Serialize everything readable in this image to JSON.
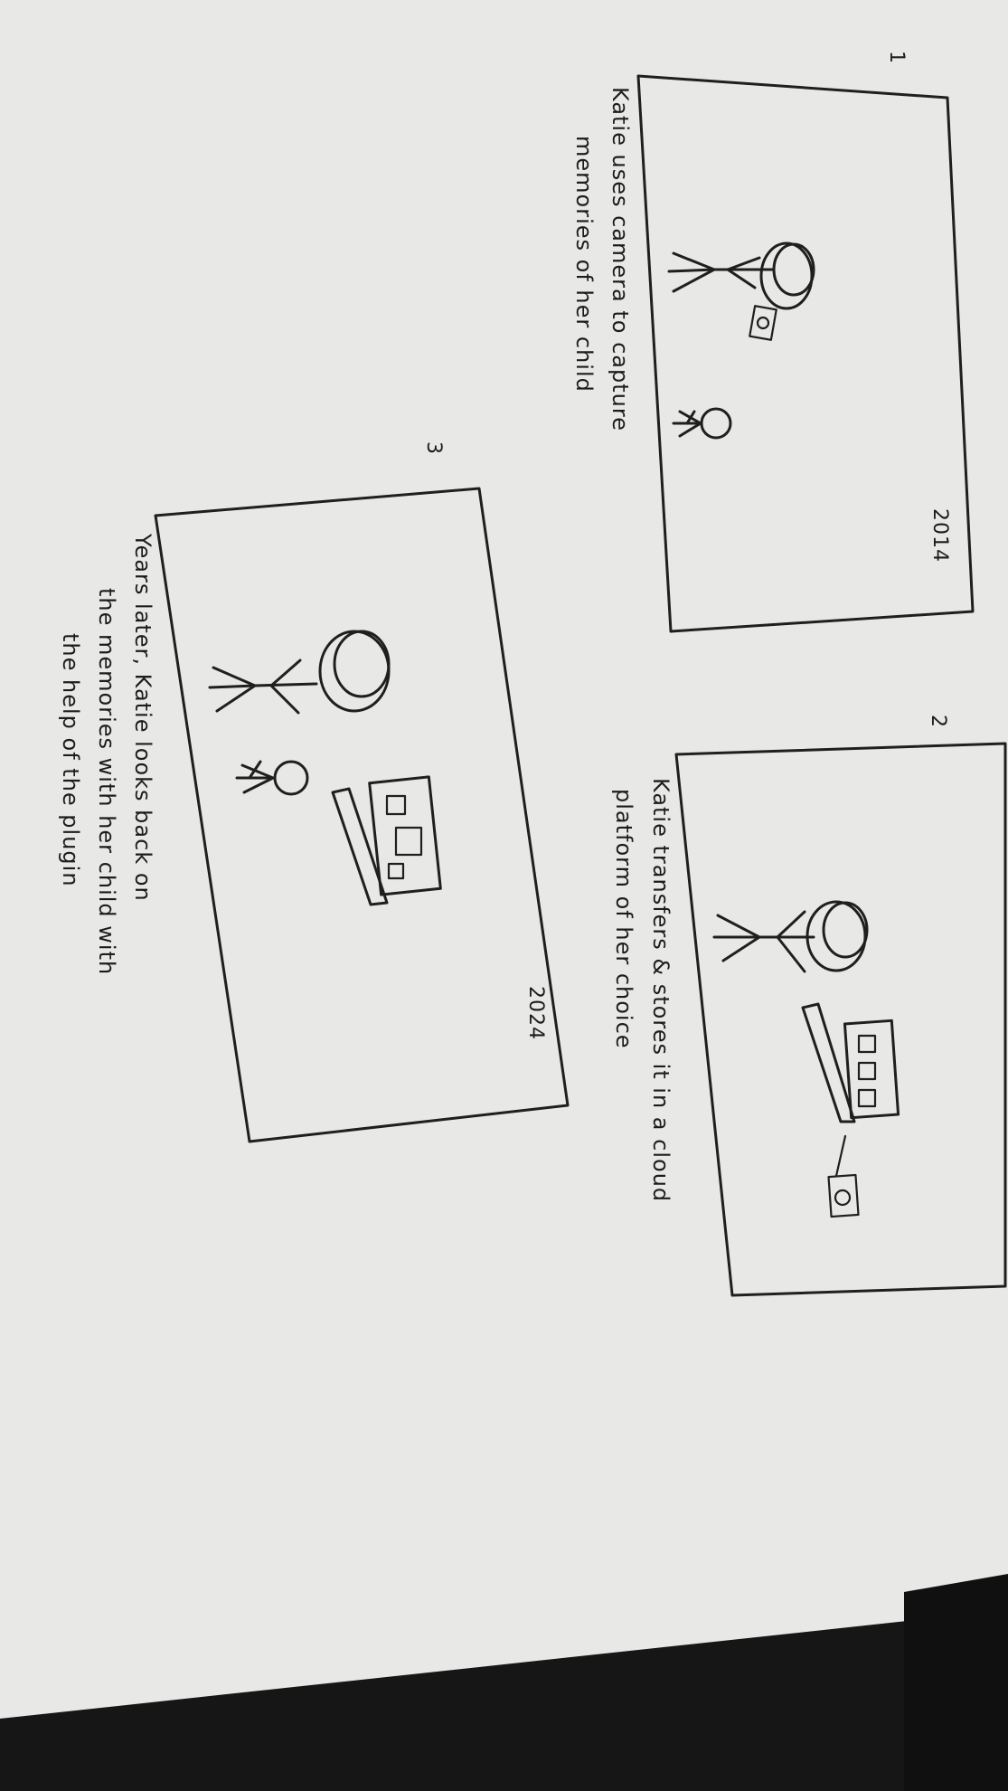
{
  "storyboard": {
    "panels": [
      {
        "number": "1",
        "year": "2014",
        "caption_line1": "Katie uses camera to capture",
        "caption_line2": "memories of her child"
      },
      {
        "number": "2",
        "year": "",
        "caption_line1": "Katie transfers & stores it in a cloud",
        "caption_line2": "platform of her choice"
      },
      {
        "number": "3",
        "year": "2024",
        "caption_line1": "Years later, Katie looks back on",
        "caption_line2": "the memories with her child with",
        "caption_line3": "the help of the plugin"
      }
    ]
  },
  "colors": {
    "paper": "#e9e9e7",
    "ink": "#1f1f1f",
    "shadow": "#111111"
  }
}
